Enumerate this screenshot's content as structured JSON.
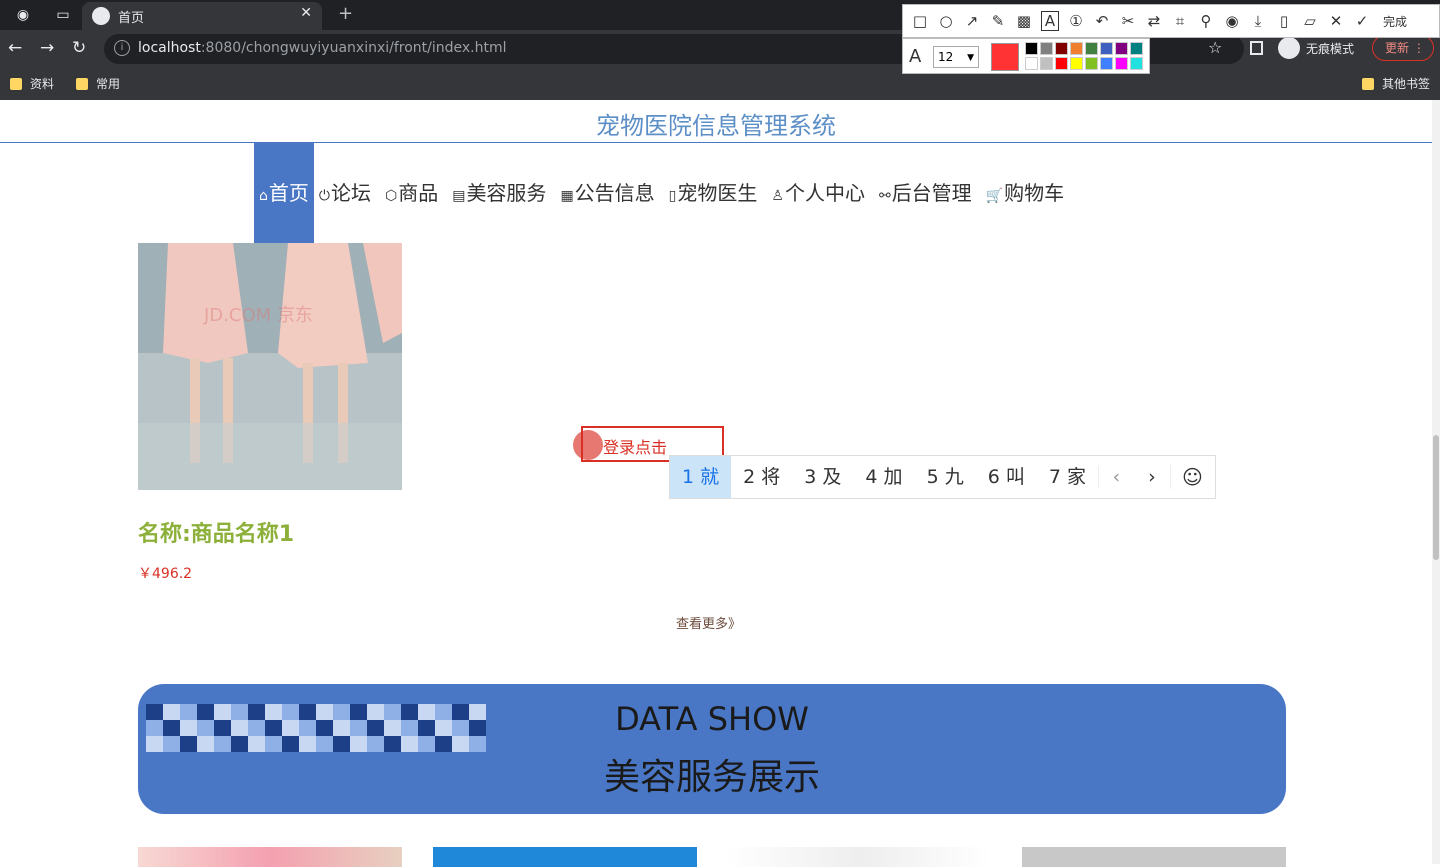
{
  "browser": {
    "tab_title": "首页",
    "url_host": "localhost",
    "url_rest": ":8080/chongwuyiyuanxinxi/front/index.html",
    "incognito_label": "无痕模式",
    "update_label": "更新",
    "bookmarks": [
      "资料",
      "常用"
    ],
    "other_bookmarks": "其他书签"
  },
  "screenshot_tool": {
    "done_label": "完成",
    "font_size": "12",
    "current_color": "#ff3333",
    "palette": [
      "#000000",
      "#808080",
      "#800000",
      "#f08030",
      "#408040",
      "#4060c0",
      "#800080",
      "#008080",
      "#ffffff",
      "#c0c0c0",
      "#ff0000",
      "#ffff00",
      "#80c020",
      "#4080ff",
      "#ff00ff",
      "#20e0e0"
    ]
  },
  "site": {
    "title": "宠物医院信息管理系统",
    "nav": [
      {
        "icon": "⌂",
        "label": "首页"
      },
      {
        "icon": "⏻",
        "label": "论坛"
      },
      {
        "icon": "⬡",
        "label": "商品"
      },
      {
        "icon": "▤",
        "label": "美容服务"
      },
      {
        "icon": "▦",
        "label": "公告信息"
      },
      {
        "icon": "▯",
        "label": "宠物医生"
      },
      {
        "icon": "♙",
        "label": "个人中心"
      },
      {
        "icon": "⚯",
        "label": "后台管理"
      },
      {
        "icon": "🛒",
        "label": "购物车"
      }
    ],
    "product": {
      "name": "名称:商品名称1",
      "price": "￥496.2",
      "watermark": "JD.COM 京东"
    },
    "more_link": "查看更多》",
    "banner": {
      "line1": "DATA SHOW",
      "line2": "美容服务展示"
    }
  },
  "ime": {
    "input_text": "登录点击",
    "candidates": [
      "1 就",
      "2 将",
      "3 及",
      "4 加",
      "5 九",
      "6 叫",
      "7 家"
    ]
  }
}
